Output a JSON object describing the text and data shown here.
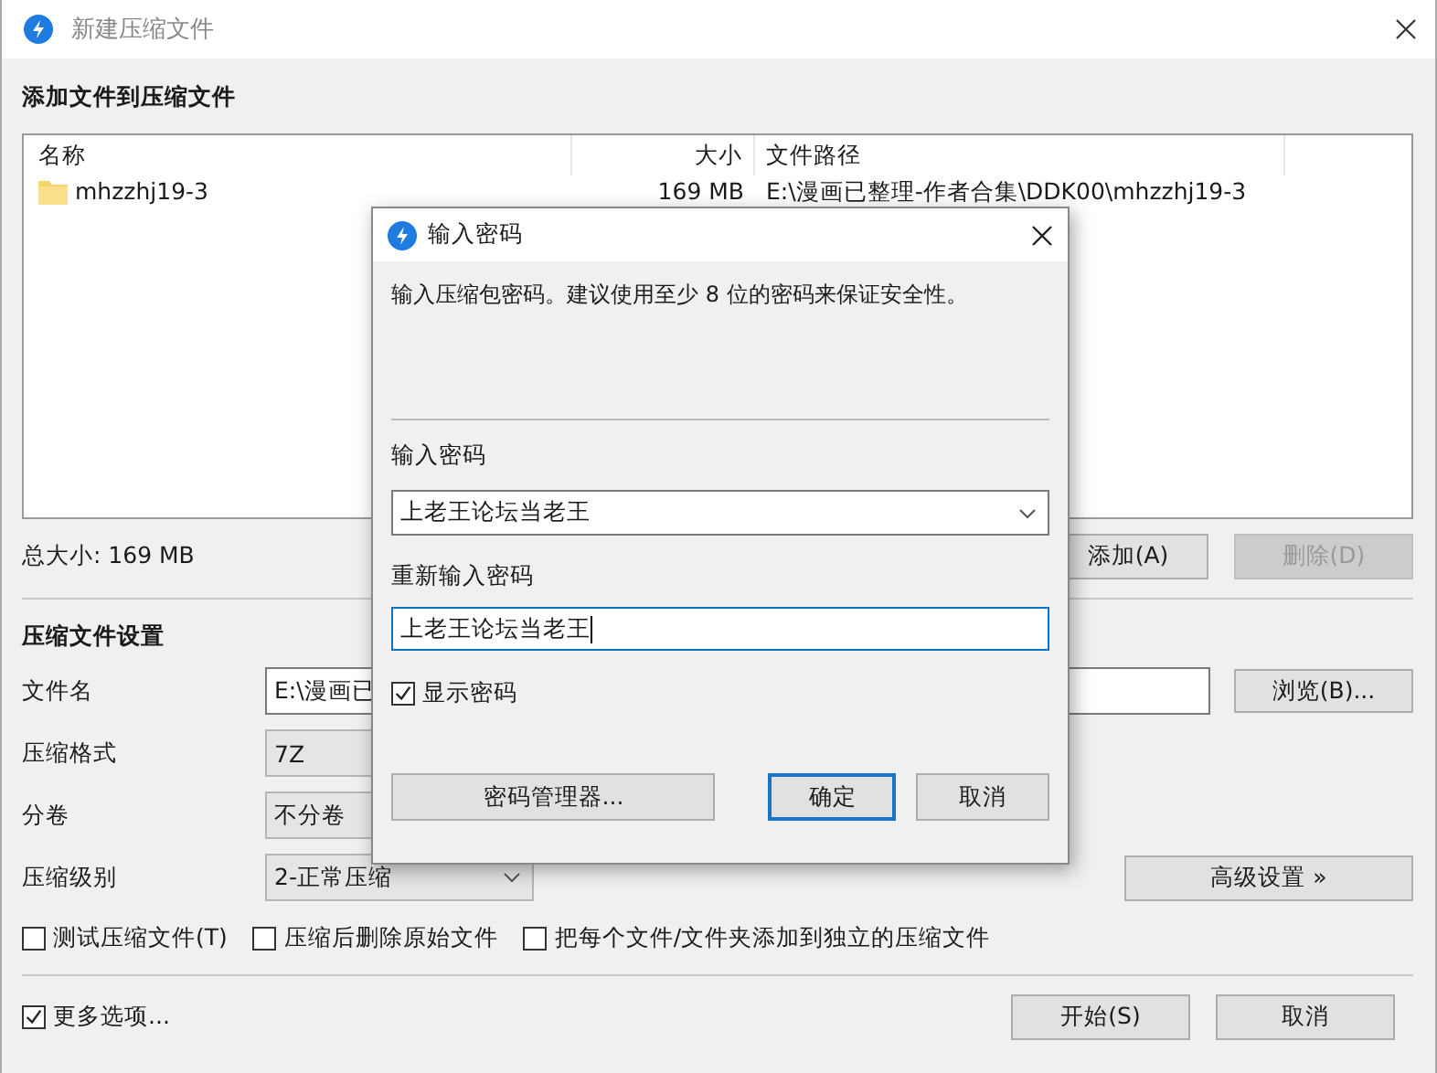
{
  "window": {
    "title": "新建压缩文件"
  },
  "add_section": {
    "heading": "添加文件到压缩文件",
    "columns": [
      "名称",
      "大小",
      "文件路径"
    ],
    "rows": [
      {
        "name": "mhzzhj19-3",
        "size": "169 MB",
        "path": "E:\\漫画已整理-作者合集\\DDK00\\mhzzhj19-3"
      }
    ],
    "total": "总大小: 169 MB",
    "buttons": [
      {
        "label": "添加(A)",
        "disabled": false
      },
      {
        "label": "删除(D)",
        "disabled": true
      }
    ]
  },
  "settings": {
    "heading": "压缩文件设置",
    "fields": [
      {
        "label": "文件名",
        "kind": "input",
        "value": "E:\\漫画已"
      },
      {
        "label": "压缩格式",
        "kind": "readonly",
        "value": "7Z"
      },
      {
        "label": "分卷",
        "kind": "readonly",
        "value": "不分卷"
      },
      {
        "label": "压缩级别",
        "kind": "dropdown",
        "value": "2-正常压缩"
      }
    ],
    "browse_button": "浏览(B)...",
    "advanced_button": "高级设置 »",
    "options": [
      {
        "label": "测试压缩文件(T)",
        "checked": false
      },
      {
        "label": "压缩后删除原始文件",
        "checked": false
      },
      {
        "label": "把每个文件/文件夹添加到独立的压缩文件",
        "checked": false
      }
    ]
  },
  "more_options": {
    "label": "更多选项...",
    "checked": true
  },
  "footer_buttons": [
    "开始(S)",
    "取消"
  ],
  "dialog": {
    "title": "输入密码",
    "description": "输入压缩包密码。建议使用至少 8 位的密码来保证安全性。",
    "password_label": "输入密码",
    "password": "上老王论坛当老王",
    "confirm_label": "重新输入密码",
    "confirm": "上老王论坛当老王",
    "show_password": {
      "label": "显示密码",
      "checked": true
    },
    "buttons": [
      {
        "label": "密码管理器...",
        "default": false
      },
      {
        "label": "确定",
        "default": true
      },
      {
        "label": "取消",
        "default": false
      }
    ]
  }
}
